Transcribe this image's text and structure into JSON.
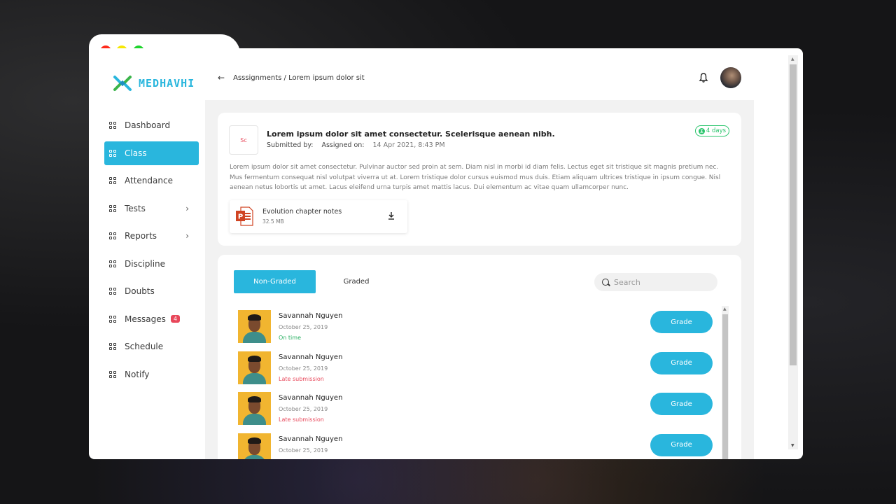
{
  "brand": {
    "name": "MEDHAVHI"
  },
  "sidebar": {
    "items": [
      {
        "label": "Dashboard"
      },
      {
        "label": "Class",
        "active": true
      },
      {
        "label": "Attendance"
      },
      {
        "label": "Tests",
        "chevron": "chevron-right-icon"
      },
      {
        "label": "Reports",
        "chevron": "chevron-right-icon"
      },
      {
        "label": "Discipline"
      },
      {
        "label": "Doubts"
      },
      {
        "label": "Messages",
        "badge": "4"
      },
      {
        "label": "Schedule"
      },
      {
        "label": "Notify"
      }
    ]
  },
  "header": {
    "back_icon": "arrow-left-icon",
    "breadcrumb": "Asssignments / Lorem ipsum dolor sit",
    "notification_icon": "bell-icon"
  },
  "assignment": {
    "subject_code": "Sc",
    "title": "Lorem ipsum dolor sit amet consectetur. Scelerisque aenean nibh.",
    "submitted_by_label": "Submitted by:",
    "assigned_on_label": "Assigned on:",
    "assigned_on": "14 Apr 2021, 8:43 PM",
    "days_left": "4 days",
    "description": "Lorem ipsum dolor sit amet consectetur. Pulvinar auctor sed proin at sem. Diam nisl in morbi id diam felis. Lectus eget sit tristique sit magnis pretium nec. Mus fermentum consequat nisl volutpat viverra ut at. Lorem tristique dolor cursus euismod mus duis. Etiam aliquam ultrices tristique in ipsum congue. Nisl aenean netus lobortis ut amet. Lacus eleifend urna turpis amet mattis lacus. Dui elementum ac vitae quam ullamcorper nunc.",
    "attachment": {
      "name": "Evolution chapter notes",
      "size": "32.5 MB",
      "icon": "powerpoint-file-icon",
      "action_icon": "download-icon"
    }
  },
  "submissions": {
    "tabs": [
      {
        "label": "Non-Graded",
        "active": true
      },
      {
        "label": "Graded"
      }
    ],
    "search_placeholder": "Search",
    "grade_label": "Grade",
    "rows": [
      {
        "name": "Savannah Nguyen",
        "date": "October 25, 2019",
        "status": "On time"
      },
      {
        "name": "Savannah Nguyen",
        "date": "October 25, 2019",
        "status": "Late submission"
      },
      {
        "name": "Savannah Nguyen",
        "date": "October 25, 2019",
        "status": "Late submission"
      },
      {
        "name": "Savannah Nguyen",
        "date": "October 25, 2019",
        "status": ""
      }
    ]
  },
  "colors": {
    "accent": "#29b6dd",
    "on_time": "#29b062",
    "late": "#e8475a",
    "days_badge": "#29c46b"
  }
}
